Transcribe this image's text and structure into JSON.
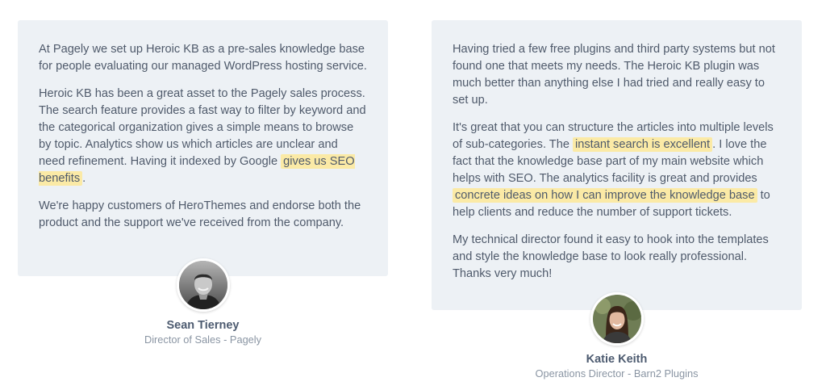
{
  "testimonials": [
    {
      "paragraphs": [
        [
          {
            "t": "At Pagely we set up Heroic KB as a pre-sales knowledge base for people evaluating our managed WordPress hosting service."
          }
        ],
        [
          {
            "t": "Heroic KB has been a great asset to the Pagely sales process. The search feature provides a fast way to filter by keyword and the categorical organization gives a simple means to browse by topic. Analytics show us which articles are unclear and need refinement. Having it indexed by Google "
          },
          {
            "t": "gives us SEO benefits",
            "hl": true
          },
          {
            "t": "."
          }
        ],
        [
          {
            "t": "We're happy customers of HeroThemes and endorse both the product and the support we've received from the company."
          }
        ]
      ],
      "name": "Sean Tierney",
      "role": "Director of Sales - Pagely",
      "avatar_icon": "person-photo-male"
    },
    {
      "paragraphs": [
        [
          {
            "t": "Having tried a few free plugins and third party systems but not found one that meets my needs. The Heroic KB plugin was much better than anything else I had tried and really easy to set up."
          }
        ],
        [
          {
            "t": "It's great that you can structure the articles into multiple levels of sub-categories. The "
          },
          {
            "t": "instant search is excellent",
            "hl": true
          },
          {
            "t": ". I love the fact that the knowledge base part of my main website which helps with SEO. The analytics facility is great and provides "
          },
          {
            "t": "concrete ideas on how I can improve the knowledge base",
            "hl": true
          },
          {
            "t": " to help clients and reduce the number of support tickets."
          }
        ],
        [
          {
            "t": "My technical director found it easy to hook into the templates and style the knowledge base to look really professional. Thanks very much!"
          }
        ]
      ],
      "name": "Katie Keith",
      "role": "Operations Director - Barn2 Plugins",
      "avatar_icon": "person-photo-female"
    }
  ],
  "colors": {
    "card_bg": "#edf1f5",
    "highlight": "#fbeaa6",
    "text": "#4f5a6b",
    "name": "#4d5b70",
    "role": "#8a95a3"
  }
}
